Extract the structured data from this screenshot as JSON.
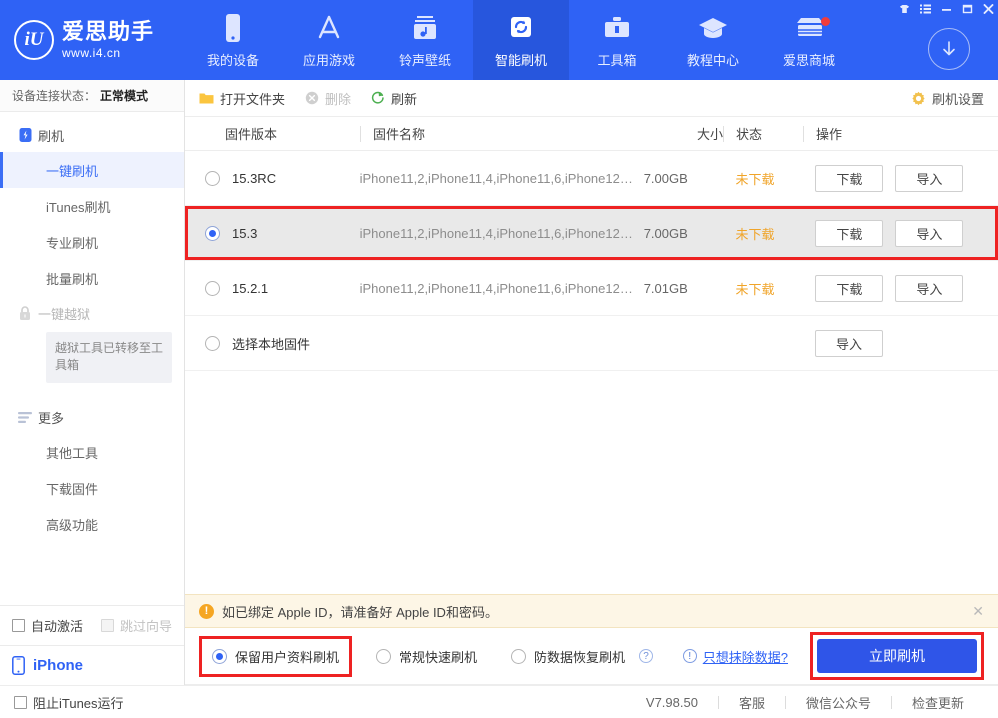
{
  "app": {
    "brand_name": "爱思助手",
    "brand_url": "www.i4.cn",
    "logo_glyph": "iU"
  },
  "header": {
    "tabs": [
      {
        "label": "我的设备",
        "icon": "phone-icon",
        "active": false,
        "badge": false
      },
      {
        "label": "应用游戏",
        "icon": "appstore-icon",
        "active": false,
        "badge": false
      },
      {
        "label": "铃声壁纸",
        "icon": "music-icon",
        "active": false,
        "badge": false
      },
      {
        "label": "智能刷机",
        "icon": "refresh-icon",
        "active": true,
        "badge": false
      },
      {
        "label": "工具箱",
        "icon": "toolbox-icon",
        "active": false,
        "badge": false
      },
      {
        "label": "教程中心",
        "icon": "graduation-icon",
        "active": false,
        "badge": false
      },
      {
        "label": "爱思商城",
        "icon": "store-icon",
        "active": false,
        "badge": true
      }
    ],
    "window_buttons": [
      {
        "name": "skin-icon",
        "glyph": "♟"
      },
      {
        "name": "menu-icon",
        "glyph": "☰"
      },
      {
        "name": "minimize-icon",
        "glyph": "–"
      },
      {
        "name": "maximize-icon",
        "glyph": "▢"
      },
      {
        "name": "close-icon",
        "glyph": "✕"
      }
    ],
    "download_button": "download-arrow-icon"
  },
  "sidebar": {
    "device_status_label": "设备连接状态：",
    "device_status_value": "正常模式",
    "groups": [
      {
        "label": "刷机",
        "icon": "flash-device-icon",
        "dim": false,
        "items": [
          {
            "label": "一键刷机",
            "active": true
          },
          {
            "label": "iTunes刷机",
            "active": false
          },
          {
            "label": "专业刷机",
            "active": false
          },
          {
            "label": "批量刷机",
            "active": false
          }
        ]
      },
      {
        "label": "一键越狱",
        "icon": "lock-icon",
        "dim": true,
        "items": [],
        "note": "越狱工具已转移至工具箱"
      },
      {
        "label": "更多",
        "icon": "more-lines-icon",
        "dim": false,
        "items": [
          {
            "label": "其他工具",
            "active": false
          },
          {
            "label": "下载固件",
            "active": false
          },
          {
            "label": "高级功能",
            "active": false
          }
        ]
      }
    ],
    "checkboxes": [
      {
        "label": "自动激活",
        "checked": false,
        "disabled": false
      },
      {
        "label": "跳过向导",
        "checked": false,
        "disabled": true
      }
    ],
    "device": {
      "label": "iPhone",
      "icon": "iphone-icon"
    }
  },
  "main": {
    "toolbar": {
      "open_folder": "打开文件夹",
      "delete": "删除",
      "refresh": "刷新",
      "settings": "刷机设置"
    },
    "columns": {
      "version": "固件版本",
      "name": "固件名称",
      "size": "大小",
      "status": "状态",
      "action": "操作"
    },
    "rows": [
      {
        "version": "15.3RC",
        "name": "iPhone11,2,iPhone11,4,iPhone11,6,iPhone12,...",
        "size": "7.00GB",
        "status": "未下载",
        "selected": false,
        "highlighted": false,
        "buttons": [
          "下载",
          "导入"
        ]
      },
      {
        "version": "15.3",
        "name": "iPhone11,2,iPhone11,4,iPhone11,6,iPhone12,...",
        "size": "7.00GB",
        "status": "未下载",
        "selected": true,
        "highlighted": true,
        "buttons": [
          "下载",
          "导入"
        ]
      },
      {
        "version": "15.2.1",
        "name": "iPhone11,2,iPhone11,4,iPhone11,6,iPhone12,...",
        "size": "7.01GB",
        "status": "未下载",
        "selected": false,
        "highlighted": false,
        "buttons": [
          "下载",
          "导入"
        ]
      },
      {
        "version": "选择本地固件",
        "name": "",
        "size": "",
        "status": "",
        "selected": false,
        "highlighted": false,
        "buttons": [
          "导入"
        ]
      }
    ]
  },
  "notice": {
    "text": "如已绑定 Apple ID，请准备好 Apple ID和密码。",
    "close": "✕"
  },
  "actionbar": {
    "options": [
      {
        "label": "保留用户资料刷机",
        "checked": true,
        "boxed": true,
        "help": false
      },
      {
        "label": "常规快速刷机",
        "checked": false,
        "boxed": false,
        "help": false
      },
      {
        "label": "防数据恢复刷机",
        "checked": false,
        "boxed": false,
        "help": true
      }
    ],
    "erase_link": "只想抹除数据?",
    "flash_button": "立即刷机"
  },
  "statusbar": {
    "block_itunes": "阻止iTunes运行",
    "version": "V7.98.50",
    "links": [
      "客服",
      "微信公众号",
      "检查更新"
    ]
  },
  "colors": {
    "brand_blue": "#2f62f5",
    "active_tab": "#2756dd",
    "accent_button": "#2f55e8",
    "highlight_red": "#ee2222",
    "status_orange": "#f0a429",
    "notice_bg": "#fdf6e6",
    "selected_row": "#e9e9e9"
  }
}
